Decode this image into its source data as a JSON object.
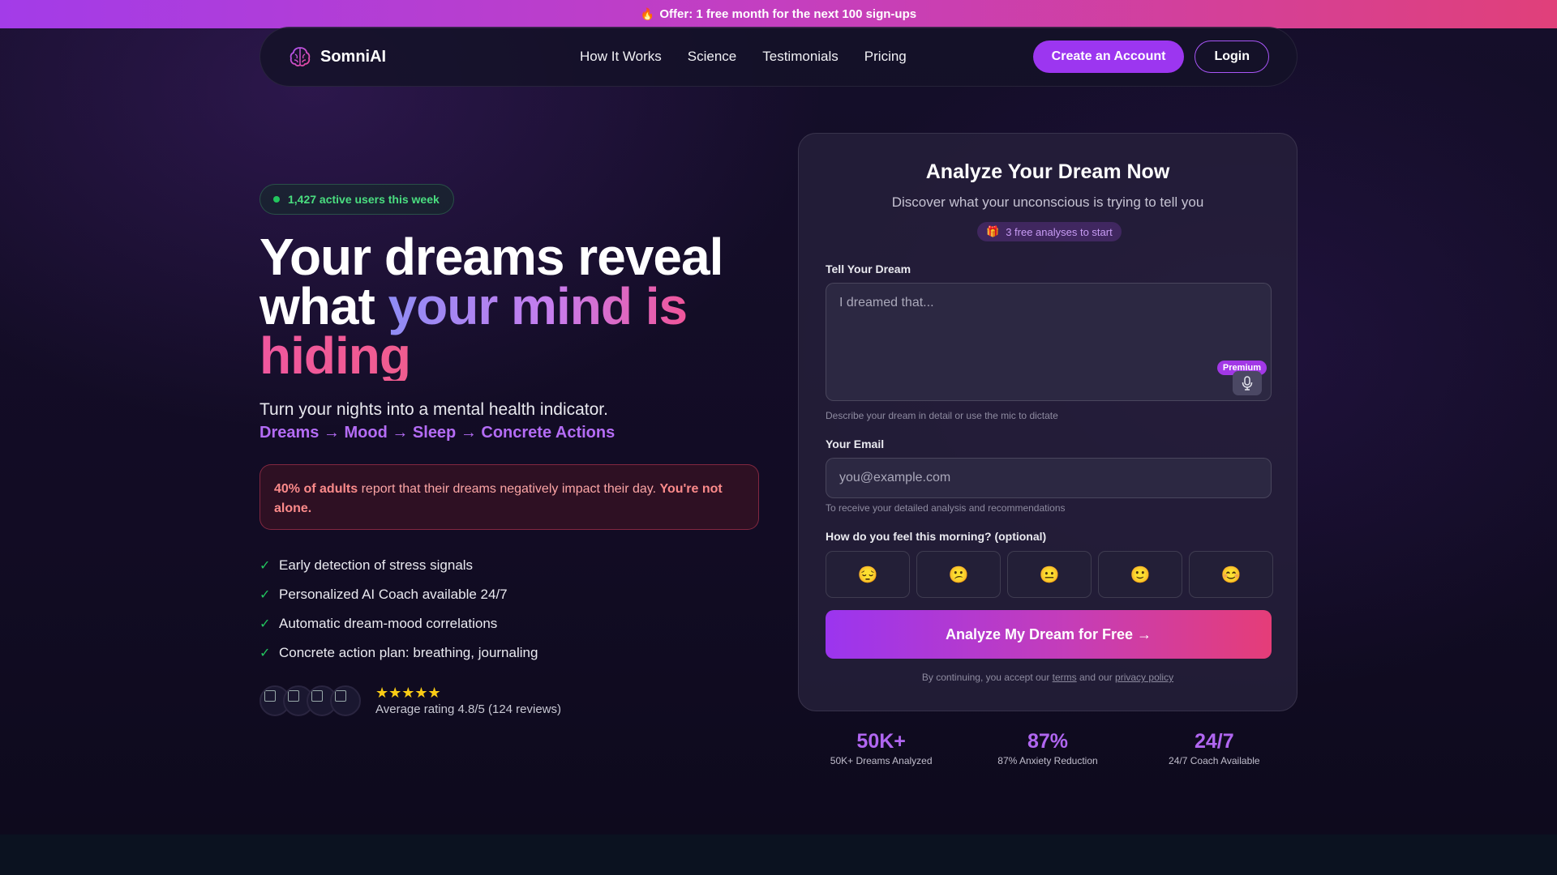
{
  "colors": {
    "accent": "#9c36f0",
    "success": "#22c55e",
    "alert": "#fb8a8a",
    "star": "#facc15",
    "offer_gradient": [
      "#a33ce8",
      "#e0407a"
    ]
  },
  "offer": {
    "icon": "flame-icon",
    "text": "Offer: 1 free month for the next 100 sign-ups"
  },
  "nav": {
    "brand": "SomniAI",
    "brand_icon": "brain-icon",
    "links": [
      "How It Works",
      "Science",
      "Testimonials",
      "Pricing"
    ],
    "create_account": "Create an Account",
    "login": "Login"
  },
  "hero": {
    "active_users": "1,427 active users this week",
    "title_line1": "Your dreams reveal",
    "title_line2_plain": "what ",
    "title_line2_gradient": "your mind is",
    "title_line3": "hiding",
    "subtitle": "Turn your nights into a mental health indicator.",
    "flow": "Dreams → Mood → Sleep → Concrete Actions",
    "stat_bold": "40% of adults",
    "stat_text": " report that their dreams negatively impact their day. ",
    "stat_tail": "You're not alone.",
    "features": [
      "Early detection of stress signals",
      "Personalized AI Coach available 24/7",
      "Automatic dream-mood correlations",
      "Concrete action plan: breathing, journaling"
    ],
    "stars": "★★★★★",
    "rating_text": "Average rating 4.8/5 (124 reviews)"
  },
  "form": {
    "title": "Analyze Your Dream Now",
    "subtitle": "Discover what your unconscious is trying to tell you",
    "free_icon": "gift-icon",
    "free_pill": "3 free analyses to start",
    "dream_label": "Tell Your Dream",
    "dream_placeholder": "I dreamed that...",
    "dream_value": "",
    "premium_badge": "Premium",
    "mic_icon": "microphone-icon",
    "dream_hint": "Describe your dream in detail or use the mic to dictate",
    "email_label": "Your Email",
    "email_placeholder": "you@example.com",
    "email_value": "",
    "email_hint": "To receive your detailed analysis and recommendations",
    "mood_label": "How do you feel this morning? (optional)",
    "moods": [
      "😔",
      "😕",
      "😐",
      "🙂",
      "😊"
    ],
    "cta": "Analyze My Dream for Free →",
    "legal_prefix": "By continuing, you accept our ",
    "legal_terms": "terms",
    "legal_mid": " and our ",
    "legal_privacy": "privacy policy"
  },
  "stats": [
    {
      "value": "50K+",
      "label": "50K+ Dreams Analyzed"
    },
    {
      "value": "87%",
      "label": "87% Anxiety Reduction"
    },
    {
      "value": "24/7",
      "label": "24/7 Coach Available"
    }
  ]
}
